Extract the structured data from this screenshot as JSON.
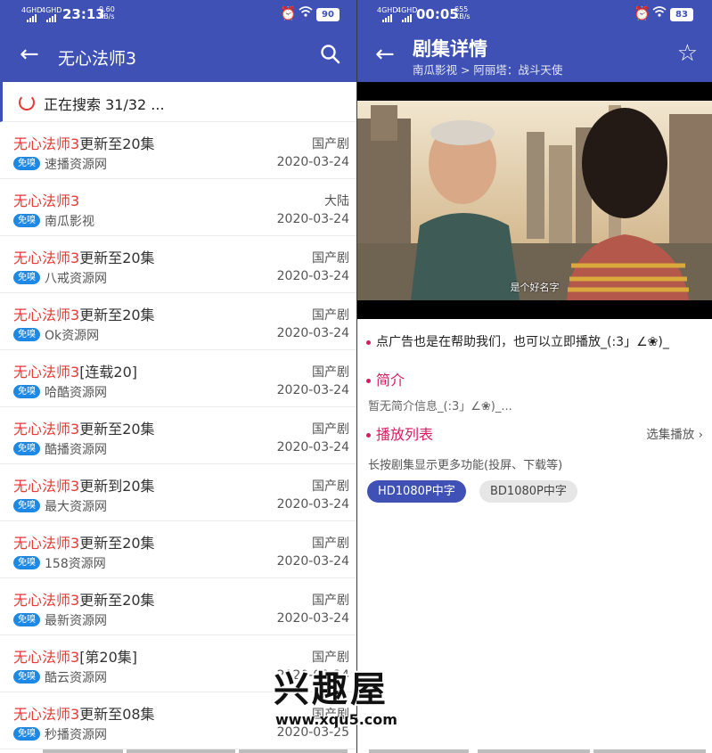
{
  "left": {
    "status": {
      "signal": "4GHD",
      "time": "23:13",
      "speed": "0.60 KB/s",
      "battery": "90"
    },
    "appbar": {
      "title": "无心法师3"
    },
    "searching": {
      "text": "正在搜索 31/32 ..."
    },
    "badge_label": "免嗅",
    "results": [
      {
        "title_hl": "无心法师3",
        "title_rest": "更新至20集",
        "category": "国产剧",
        "source": "速播资源网",
        "date": "2020-03-24"
      },
      {
        "title_hl": "无心法师3",
        "title_rest": "",
        "category": "大陆",
        "source": "南瓜影视",
        "date": "2020-03-24"
      },
      {
        "title_hl": "无心法师3",
        "title_rest": "更新至20集",
        "category": "国产剧",
        "source": "八戒资源网",
        "date": "2020-03-24"
      },
      {
        "title_hl": "无心法师3",
        "title_rest": "更新至20集",
        "category": "国产剧",
        "source": "Ok资源网",
        "date": "2020-03-24"
      },
      {
        "title_hl": "无心法师3",
        "title_rest": "[连载20]",
        "category": "国产剧",
        "source": "哈酷资源网",
        "date": "2020-03-24"
      },
      {
        "title_hl": "无心法师3",
        "title_rest": "更新至20集",
        "category": "国产剧",
        "source": "酷播资源网",
        "date": "2020-03-24"
      },
      {
        "title_hl": "无心法师3",
        "title_rest": "更新到20集",
        "category": "国产剧",
        "source": "最大资源网",
        "date": "2020-03-24"
      },
      {
        "title_hl": "无心法师3",
        "title_rest": "更新至20集",
        "category": "国产剧",
        "source": "158资源网",
        "date": "2020-03-24"
      },
      {
        "title_hl": "无心法师3",
        "title_rest": "更新至20集",
        "category": "国产剧",
        "source": "最新资源网",
        "date": "2020-03-24"
      },
      {
        "title_hl": "无心法师3",
        "title_rest": "[第20集]",
        "category": "国产剧",
        "source": "酷云资源网",
        "date": "2020-03-24"
      },
      {
        "title_hl": "无心法师3",
        "title_rest": "更新至08集",
        "category": "国产剧",
        "source": "秒播资源网",
        "date": "2020-03-25"
      }
    ]
  },
  "right": {
    "status": {
      "signal": "4GHD",
      "time": "00:05",
      "speed": "655 KB/s",
      "battery": "83"
    },
    "appbar": {
      "title": "剧集详情",
      "breadcrumb": "南瓜影视 > 阿丽塔：战斗天使"
    },
    "player": {
      "subtitle": "是个好名字"
    },
    "ad_text": "点广告也是在帮助我们，也可以立即播放_(:3」∠❀)_",
    "intro": {
      "heading": "简介",
      "text": "暂无简介信息_(:3」∠❀)_..."
    },
    "playlist": {
      "heading": "播放列表",
      "pick_label": "选集播放",
      "hint": "长按剧集显示更多功能(投屏、下载等)",
      "episodes": [
        "HD1080P中字",
        "BD1080P中字"
      ]
    }
  },
  "watermark": {
    "logo": "兴趣屋",
    "url": "www.xqu5.com"
  },
  "colors": {
    "primary": "#3f51b5",
    "highlight": "#e53935",
    "accent": "#d81b60",
    "badge": "#1e88e5"
  }
}
